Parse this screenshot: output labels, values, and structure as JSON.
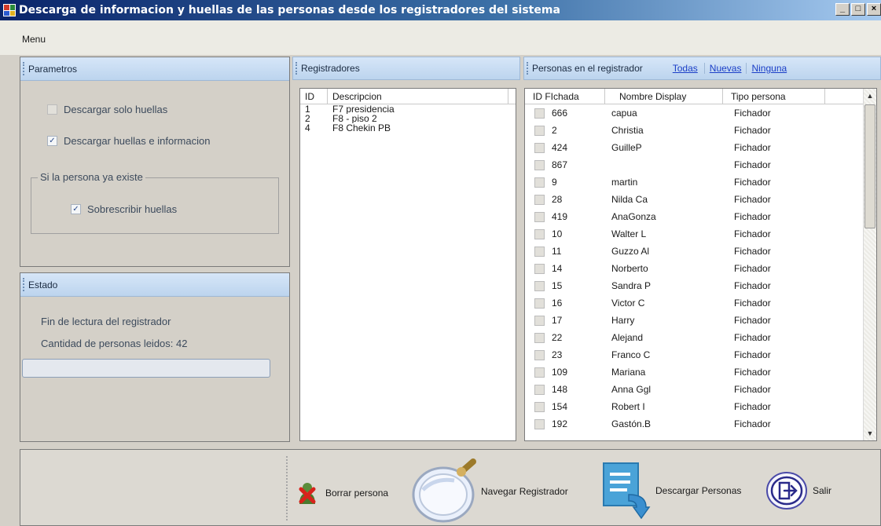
{
  "window": {
    "title": "Descarga de informacion y huellas de las personas desde los registradores del sistema",
    "minimize": "_",
    "maximize": "□",
    "close": "×"
  },
  "menu": {
    "label": "Menu"
  },
  "parametros": {
    "header": "Parametros",
    "solo_huellas": {
      "label": "Descargar solo huellas",
      "checked": false
    },
    "huellas_info": {
      "label": "Descargar huellas e informacion",
      "checked": true
    },
    "group": {
      "legend": "Si la persona ya existe",
      "sobrescribir": {
        "label": "Sobrescribir huellas",
        "checked": true
      }
    },
    "check_mark": "✓"
  },
  "estado": {
    "header": "Estado",
    "line1": "Fin de lectura del registrador",
    "line2": "Cantidad de personas leidos: 42",
    "progress": 0
  },
  "registradores": {
    "header": "Registradores",
    "columns": [
      "ID",
      "Descripcion"
    ],
    "rows": [
      {
        "id": "1",
        "desc": "F7 presidencia"
      },
      {
        "id": "2",
        "desc": "F8 - piso 2"
      },
      {
        "id": "4",
        "desc": "F8 Chekin PB"
      }
    ]
  },
  "personas": {
    "header": "Personas en el registrador",
    "links": {
      "todas": "Todas",
      "nuevas": "Nuevas",
      "ninguna": "Ninguna"
    },
    "columns": [
      "ID FIchada",
      "Nombre Display",
      "Tipo persona"
    ],
    "rows": [
      {
        "id": "666",
        "nombre": "capua",
        "tipo": "Fichador"
      },
      {
        "id": "2",
        "nombre": "Christia",
        "tipo": "Fichador"
      },
      {
        "id": "424",
        "nombre": "GuilleP",
        "tipo": "Fichador"
      },
      {
        "id": "867",
        "nombre": "",
        "tipo": "Fichador"
      },
      {
        "id": "9",
        "nombre": "martin",
        "tipo": "Fichador"
      },
      {
        "id": "28",
        "nombre": "Nilda Ca",
        "tipo": "Fichador"
      },
      {
        "id": "419",
        "nombre": "AnaGonza",
        "tipo": "Fichador"
      },
      {
        "id": "10",
        "nombre": "Walter L",
        "tipo": "Fichador"
      },
      {
        "id": "11",
        "nombre": "Guzzo Al",
        "tipo": "Fichador"
      },
      {
        "id": "14",
        "nombre": "Norberto",
        "tipo": "Fichador"
      },
      {
        "id": "15",
        "nombre": "Sandra P",
        "tipo": "Fichador"
      },
      {
        "id": "16",
        "nombre": "Victor C",
        "tipo": "Fichador"
      },
      {
        "id": "17",
        "nombre": "Harry",
        "tipo": "Fichador"
      },
      {
        "id": "22",
        "nombre": "Alejand",
        "tipo": "Fichador"
      },
      {
        "id": "23",
        "nombre": "Franco C",
        "tipo": "Fichador"
      },
      {
        "id": "109",
        "nombre": "Mariana",
        "tipo": "Fichador"
      },
      {
        "id": "148",
        "nombre": "Anna Ggl",
        "tipo": "Fichador"
      },
      {
        "id": "154",
        "nombre": "Robert I",
        "tipo": "Fichador"
      },
      {
        "id": "192",
        "nombre": "Gastón.B",
        "tipo": "Fichador"
      }
    ]
  },
  "toolbar": {
    "borrar": {
      "label": "Borrar persona",
      "icon": "delete-person-icon"
    },
    "navegar": {
      "label": "Navegar Registrador",
      "icon": "magnifier-icon"
    },
    "descargar": {
      "label": "Descargar Personas",
      "icon": "document-download-icon"
    },
    "salir": {
      "label": "Salir",
      "icon": "exit-icon"
    }
  },
  "colors": {
    "title_gradient_start": "#0a246a",
    "panel_header": "#c8dbf1",
    "link": "#1a3ec7"
  }
}
